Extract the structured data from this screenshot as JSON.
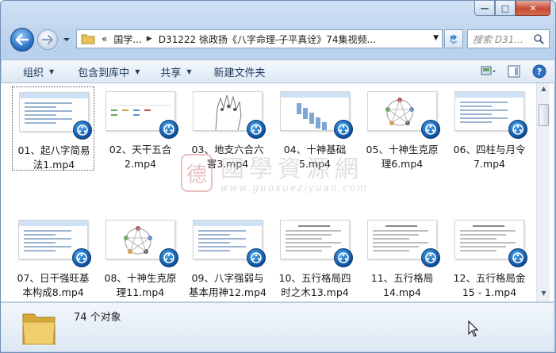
{
  "window": {
    "controls": {
      "minimize": "—",
      "maximize": "□",
      "close": "✕"
    }
  },
  "nav": {
    "breadcrumb": [
      "«",
      "国学...",
      "D31222 徐政扬《八字命理-子平真诠》74集视频..."
    ],
    "search_placeholder": "搜索 D31..."
  },
  "toolbar": {
    "items": [
      "组织",
      "包含到库中",
      "共享",
      "新建文件夹"
    ]
  },
  "files": [
    {
      "line1": "01、起八字简易",
      "line2": "法1.mp4",
      "thumb": "doc"
    },
    {
      "line1": "02、天干五合",
      "line2": "2.mp4",
      "thumb": "table"
    },
    {
      "line1": "03、地支六合六",
      "line2": "害3.mp4",
      "thumb": "hand"
    },
    {
      "line1": "04、十神基础",
      "line2": "5.mp4",
      "thumb": "list"
    },
    {
      "line1": "05、十神生克原",
      "line2": "理6.mp4",
      "thumb": "circle"
    },
    {
      "line1": "06、四柱与月令",
      "line2": "7.mp4",
      "thumb": "doc"
    },
    {
      "line1": "07、日干强旺基",
      "line2": "本构成8.mp4",
      "thumb": "doc"
    },
    {
      "line1": "08、十神生克原",
      "line2": "理11.mp4",
      "thumb": "circle"
    },
    {
      "line1": "09、八字强弱与",
      "line2": "基本用神12.mp4",
      "thumb": "doc"
    },
    {
      "line1": "10、五行格局四",
      "line2": "时之木13.mp4",
      "thumb": "text"
    },
    {
      "line1": "11、五行格局",
      "line2": "14.mp4",
      "thumb": "text"
    },
    {
      "line1": "12、五行格局金",
      "line2": "15 - 1.mp4",
      "thumb": "text"
    }
  ],
  "watermark": {
    "seal": "德",
    "title": "國學資源網",
    "url": "www.guoxueziyuan.com"
  },
  "status": {
    "count": "74 个对象"
  },
  "colors": {
    "accent": "#1c4f96",
    "badge": "#0d4f9c",
    "toolbar_text": "#1e395b"
  }
}
